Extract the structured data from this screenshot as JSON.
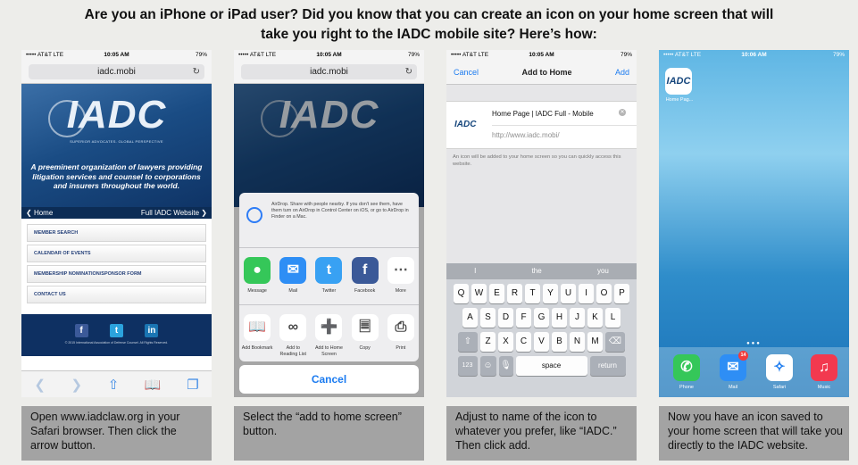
{
  "title": {
    "line1": "Are you an iPhone or iPad user? Did you know that you can create an icon on your home screen that will",
    "line2": "take you right to the IADC mobile site? Here’s how:"
  },
  "status": {
    "carrier": "••••• AT&T  LTE",
    "time": "10:05 AM",
    "time_home": "10:06 AM",
    "battery": "79%"
  },
  "screen1": {
    "url": "iadc.mobi",
    "logo": "IADC",
    "tagline": "SUPERIOR ADVOCATES. GLOBAL PERSPECTIVE",
    "mission": "A preeminent organization of lawyers providing litigation services and counsel to corporations and insurers throughout the world.",
    "nav_home": "Home",
    "nav_full": "Full IADC Website",
    "menu": [
      "MEMBER SEARCH",
      "CALENDAR OF EVENTS",
      "MEMBERSHIP NOMINATION/SPONSOR FORM",
      "CONTACT US"
    ],
    "copyright": "© 2015 International Association of Defense Counsel. All Rights Reserved."
  },
  "screen2": {
    "url": "iadc.mobi",
    "airdrop_text": "AirDrop. Share with people nearby. If you don't see them, have them turn on AirDrop in Control Center on iOS, or go to AirDrop in Finder on a Mac.",
    "share_apps": [
      "Message",
      "Mail",
      "Twitter",
      "Facebook",
      "More"
    ],
    "actions": [
      "Add Bookmark",
      "Add to Reading List",
      "Add to Home Screen",
      "Copy",
      "Print"
    ],
    "cancel": "Cancel"
  },
  "screen3": {
    "cancel": "Cancel",
    "title": "Add to Home",
    "add": "Add",
    "icon_logo": "IADC",
    "name_value": "Home Page | IADC Full - Mobile",
    "url_value": "http://www.iadc.mobi/",
    "note": "An icon will be added to your home screen so you can quickly access this website.",
    "suggestions": [
      "I",
      "the",
      "you"
    ],
    "row1": [
      "Q",
      "W",
      "E",
      "R",
      "T",
      "Y",
      "U",
      "I",
      "O",
      "P"
    ],
    "row2": [
      "A",
      "S",
      "D",
      "F",
      "G",
      "H",
      "J",
      "K",
      "L"
    ],
    "row3": [
      "Z",
      "X",
      "C",
      "V",
      "B",
      "N",
      "M"
    ],
    "num_key": "123",
    "space": "space",
    "return": "return"
  },
  "screen4": {
    "app_logo": "IADC",
    "app_label": "Home Pag...",
    "dock": [
      "Phone",
      "Mail",
      "Safari",
      "Music"
    ],
    "mail_badge": "14"
  },
  "captions": [
    "Open www.iadclaw.org in your Safari browser. Then click the arrow button.",
    "Select the “add to home screen” button.",
    "Adjust to name of the icon to whatever you prefer, like “IADC.” Then click add.",
    "Now you have an icon saved to your home screen that will take you directly to the IADC website."
  ],
  "colors": {
    "iadc_navy": "#0e3062",
    "ios_blue": "#1b7bf0",
    "caption_bg": "#a3a3a3"
  }
}
